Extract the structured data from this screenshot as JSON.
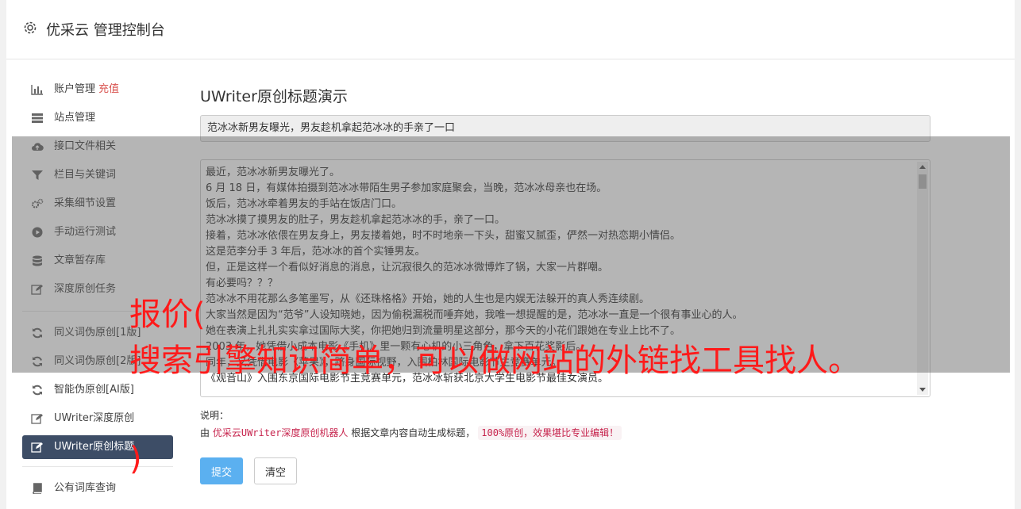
{
  "header": {
    "title": "优采云 管理控制台",
    "icon": "gear-icon"
  },
  "sidebar": {
    "items": [
      {
        "label": "账户管理",
        "badge": "充值",
        "icon": "bar-chart-icon"
      },
      {
        "label": "站点管理",
        "icon": "server-icon"
      },
      {
        "label": "接口文件相关",
        "icon": "cloud-upload-icon"
      },
      {
        "label": "栏目与关键词",
        "icon": "filter-icon"
      },
      {
        "label": "采集细节设置",
        "icon": "gears-icon"
      },
      {
        "label": "手动运行测试",
        "icon": "play-circle-icon"
      },
      {
        "label": "文章暂存库",
        "icon": "database-icon"
      },
      {
        "label": "深度原创任务",
        "icon": "edit-icon"
      },
      {
        "label": "同义词伪原创[1版]",
        "icon": "refresh-icon"
      },
      {
        "label": "同义词伪原创[2版]",
        "icon": "refresh-icon"
      },
      {
        "label": "智能伪原创[AI版]",
        "icon": "refresh-icon"
      },
      {
        "label": "UWriter深度原创",
        "icon": "edit-icon"
      },
      {
        "label": "UWriter原创标题",
        "icon": "edit-icon"
      },
      {
        "label": "公有词库查询",
        "icon": "book-icon"
      }
    ]
  },
  "content": {
    "heading": "UWriter原创标题演示",
    "title_value": "范冰冰新男友曝光，男友趁机拿起范冰冰的手亲了一口",
    "article_lines": [
      "最近，范冰冰新男友曝光了。",
      "6 月 18 日，有媒体拍摄到范冰冰带陌生男子参加家庭聚会，当晚，范冰冰母亲也在场。",
      "饭后，范冰冰牵着男友的手站在饭店门口。",
      "范冰冰摸了摸男友的肚子，男友趁机拿起范冰冰的手，亲了一口。",
      "接着，范冰冰依偎在男友身上，男友搂着她，时不时地亲一下头，甜蜜又腻歪，俨然一对热恋期小情侣。",
      "这是范李分手 3 年后，范冰冰的首个实锤男友。",
      "但，正是这样一个看似好消息的消息，让沉寂很久的范冰冰微博炸了锅，大家一片群嘲。",
      "有必要吗？？？",
      "范冰冰不用花那么多笔墨写，从《还珠格格》开始，她的人生也是内娱无法躲开的真人秀连续剧。",
      "大家当然是因为“范爷”人设知晓她，因为偷税漏税而唾弃她，我唯一想提醒的是，范冰冰一直是一个很有事业心的人。",
      "她在表演上扎扎实实拿过国际大奖，你把她归到流量明星这部分，那今天的小花们跟她在专业上比不了。",
      "2003 年，她凭借小成本电影《手机》里一颗有心机的小三角色，拿下百花奖影后。",
      "同年，又凭借电影《苹果》，跻身国际视野，入围柏林国际电影节主竞赛单元。",
      "《观音山》入围东京国际电影节主竞赛单元，范冰冰斩获北京大学生电影节最佳女演员。"
    ],
    "note_label": "说明：",
    "note_prefix": "由",
    "note_tag": "优采云UWriter深度原创机器人",
    "note_middle": "根据文章内容自动生成标题，",
    "note_tag2": "100%原创，效果堪比专业编辑！",
    "submit_label": "提交",
    "clear_label": "清空"
  },
  "ad_overlay": {
    "line1": "报价(",
    "line2": "搜索引擎知识简单，可以做网站的外链找工具找人。",
    "line3": ")"
  },
  "colors": {
    "active_nav": "#3d4d66",
    "submit": "#5bb0f0",
    "badge": "#d9534f",
    "ad_text": "#ff1a1a"
  }
}
